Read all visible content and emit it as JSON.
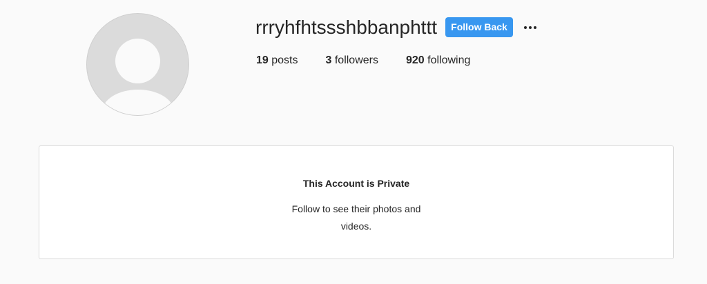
{
  "profile": {
    "username": "rrryhfhtssshbbanphttt",
    "follow_button_label": "Follow Back",
    "more_options_icon": "more-horizontal-icon",
    "stats": {
      "posts_count": "19",
      "posts_label": "posts",
      "followers_count": "3",
      "followers_label": "followers",
      "following_count": "920",
      "following_label": "following"
    }
  },
  "private_notice": {
    "title": "This Account is Private",
    "description": "Follow to see their photos and videos."
  },
  "colors": {
    "background": "#fafafa",
    "accent": "#3897f0",
    "text": "#262626",
    "card_border": "#dbdbdb"
  }
}
